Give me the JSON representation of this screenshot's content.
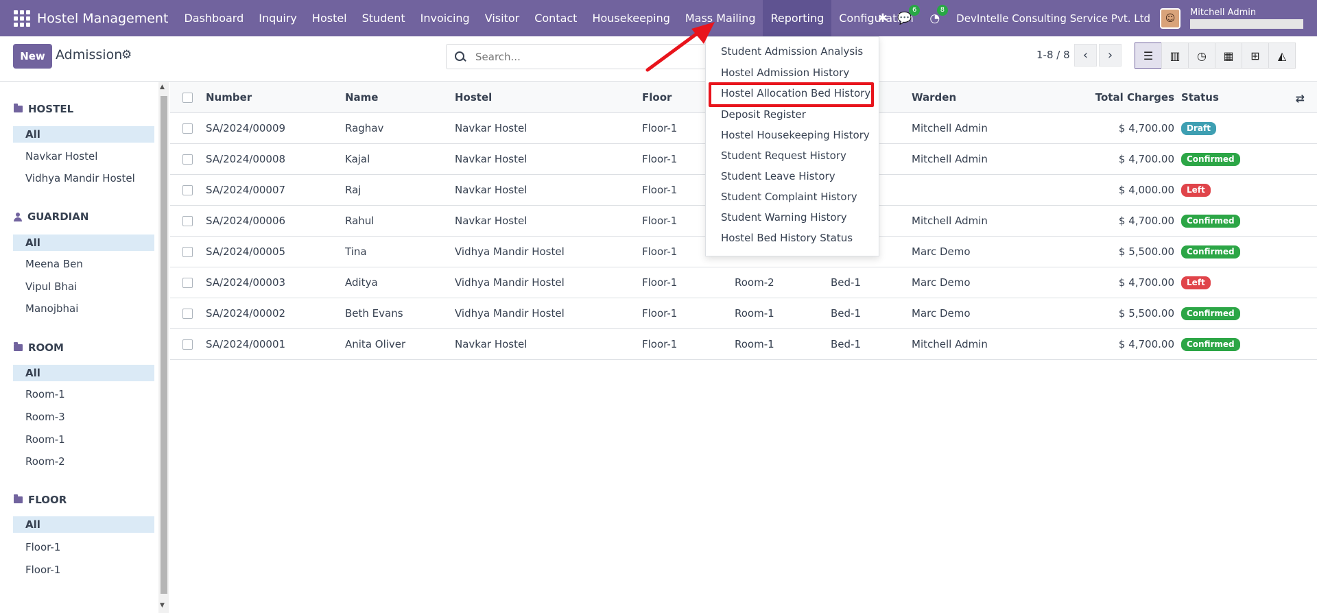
{
  "topbar": {
    "brand": "Hostel Management",
    "nav": [
      "Dashboard",
      "Inquiry",
      "Hostel",
      "Student",
      "Invoicing",
      "Visitor",
      "Contact",
      "Housekeeping",
      "Mass Mailing",
      "Reporting",
      "Configuration"
    ],
    "active_nav": "Reporting",
    "chat_count": "6",
    "activity_count": "8",
    "company": "DevIntelle Consulting Service Pvt. Ltd",
    "user_name": "Mitchell Admin"
  },
  "control": {
    "new_label": "New",
    "title": "Admission",
    "search_placeholder": "Search...",
    "pager": "1-8 / 8"
  },
  "sidebar": {
    "sections": [
      {
        "title": "HOSTEL",
        "items": [
          "All",
          "Navkar Hostel",
          "Vidhya Mandir Hostel"
        ]
      },
      {
        "title": "GUARDIAN",
        "items": [
          "All",
          "Meena Ben",
          "Vipul Bhai",
          "Manojbhai"
        ]
      },
      {
        "title": "ROOM",
        "items": [
          "All",
          "Room-1",
          "Room-3",
          "Room-1",
          "Room-2"
        ]
      },
      {
        "title": "FLOOR",
        "items": [
          "All",
          "Floor-1",
          "Floor-1"
        ]
      }
    ]
  },
  "table": {
    "headers": {
      "number": "Number",
      "name": "Name",
      "hostel": "Hostel",
      "floor": "Floor",
      "warden": "Warden",
      "total": "Total Charges",
      "status": "Status"
    },
    "rows": [
      {
        "number": "SA/2024/00009",
        "name": "Raghav",
        "hostel": "Navkar Hostel",
        "floor": "Floor-1",
        "room": "",
        "bed": "",
        "warden": "Mitchell Admin",
        "total": "$ 4,700.00",
        "status": "Draft"
      },
      {
        "number": "SA/2024/00008",
        "name": "Kajal",
        "hostel": "Navkar Hostel",
        "floor": "Floor-1",
        "room": "",
        "bed": "",
        "warden": "Mitchell Admin",
        "total": "$ 4,700.00",
        "status": "Confirmed"
      },
      {
        "number": "SA/2024/00007",
        "name": "Raj",
        "hostel": "Navkar Hostel",
        "floor": "Floor-1",
        "room": "",
        "bed": "",
        "warden": "",
        "total": "$ 4,000.00",
        "status": "Left"
      },
      {
        "number": "SA/2024/00006",
        "name": "Rahul",
        "hostel": "Navkar Hostel",
        "floor": "Floor-1",
        "room": "",
        "bed": "",
        "warden": "Mitchell Admin",
        "total": "$ 4,700.00",
        "status": "Confirmed"
      },
      {
        "number": "SA/2024/00005",
        "name": "Tina",
        "hostel": "Vidhya Mandir Hostel",
        "floor": "Floor-1",
        "room": "",
        "bed": "",
        "warden": "Marc Demo",
        "total": "$ 5,500.00",
        "status": "Confirmed"
      },
      {
        "number": "SA/2024/00003",
        "name": "Aditya",
        "hostel": "Vidhya Mandir Hostel",
        "floor": "Floor-1",
        "room": "Room-2",
        "bed": "Bed-1",
        "warden": "Marc Demo",
        "total": "$ 4,700.00",
        "status": "Left"
      },
      {
        "number": "SA/2024/00002",
        "name": "Beth Evans",
        "hostel": "Vidhya Mandir Hostel",
        "floor": "Floor-1",
        "room": "Room-1",
        "bed": "Bed-1",
        "warden": "Marc Demo",
        "total": "$ 5,500.00",
        "status": "Confirmed"
      },
      {
        "number": "SA/2024/00001",
        "name": "Anita Oliver",
        "hostel": "Navkar Hostel",
        "floor": "Floor-1",
        "room": "Room-1",
        "bed": "Bed-1",
        "warden": "Mitchell Admin",
        "total": "$ 4,700.00",
        "status": "Confirmed"
      }
    ]
  },
  "reporting_menu": {
    "items": [
      "Student Admission Analysis",
      "Hostel Admission History",
      "Hostel Allocation Bed History",
      "Deposit Register",
      "Hostel Housekeeping History",
      "Student Request History",
      "Student Leave History",
      "Student Complaint History",
      "Student Warning History",
      "Hostel Bed History Status"
    ],
    "highlighted": "Hostel Allocation Bed History"
  },
  "colors": {
    "brand": "#71639e",
    "highlight": "#e8141c",
    "draft": "#3e9fb2",
    "confirmed": "#2ca646",
    "left": "#e0444a"
  }
}
